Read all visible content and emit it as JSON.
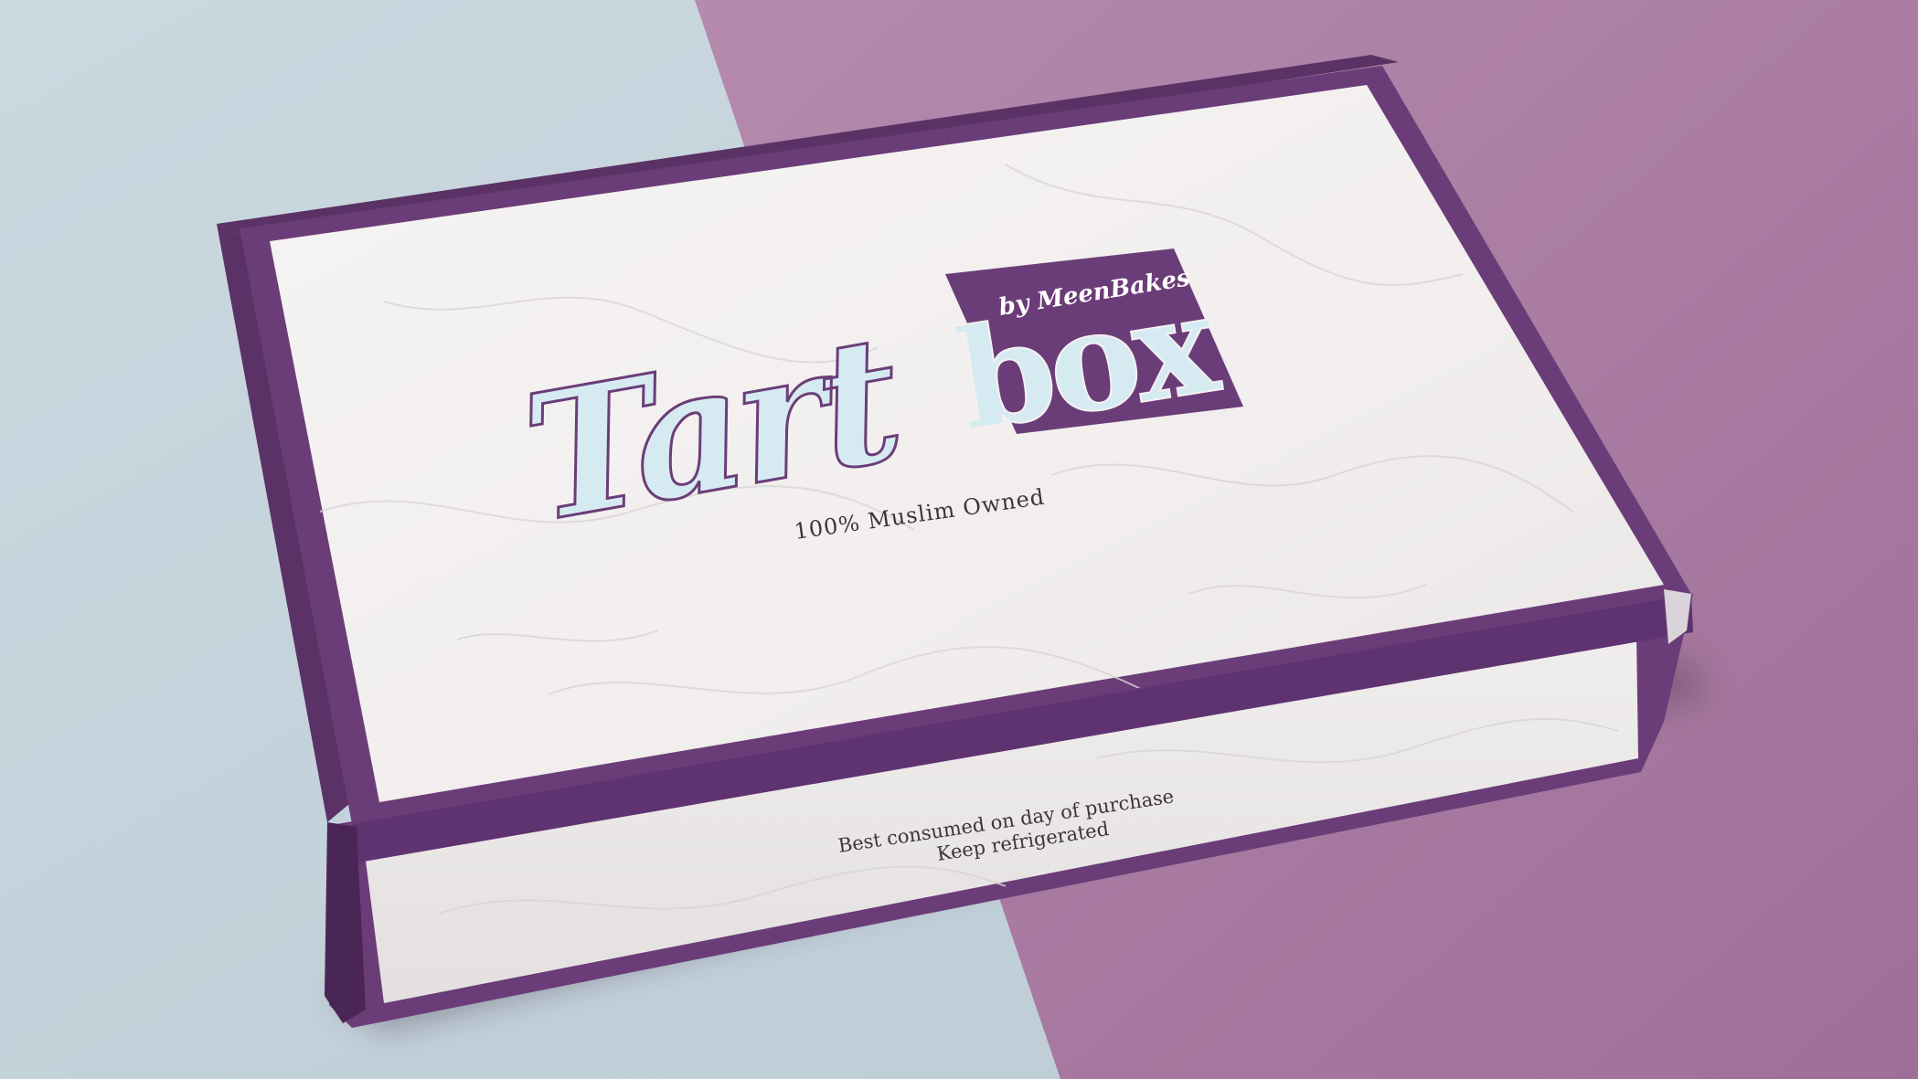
{
  "photo": {
    "subject": "Tartbox by MeenBakes packaging box",
    "colors": {
      "background_left": "#c4d3dc",
      "background_right": "#a8789f",
      "box_purple": "#6b3d78",
      "box_purple_dark": "#4e2a5a",
      "marble": "#f2efee",
      "logo_light_blue": "#d6eaf2",
      "logo_outline": "#6b3d78",
      "print_text": "#3c3540"
    }
  },
  "box": {
    "logo": {
      "word_left": "Tart",
      "word_right": "box",
      "byline": "by MeenBakes"
    },
    "tagline": "100% Muslim Owned",
    "side_text": {
      "line1": "Best consumed on day of purchase",
      "line2": "Keep refrigerated"
    }
  }
}
